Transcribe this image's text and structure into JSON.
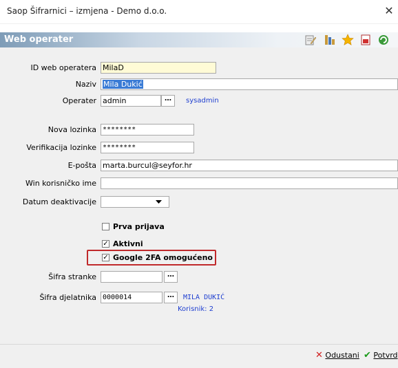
{
  "window": {
    "title": "Saop Šifrarnici – izmjena  - Demo d.o.o.",
    "close_glyph": "✕"
  },
  "header": {
    "title": "Web operater"
  },
  "form": {
    "id_label": "ID web operatera",
    "id_value": "MilaD",
    "naziv_label": "Naziv",
    "naziv_value": "Mila Dukić",
    "operater_label": "Operater",
    "operater_value": "admin",
    "operater_name": "sysadmin",
    "lozinka_label": "Nova lozinka",
    "lozinka_value": "********",
    "verif_label": "Verifikacija lozinke",
    "verif_value": "********",
    "email_label": "E-pošta",
    "email_value": "marta.burcul@seyfor.hr",
    "win_label": "Win korisničko ime",
    "win_value": "",
    "datum_label": "Datum deaktivacije",
    "datum_value": "",
    "prva_label": "Prva prijava",
    "prva_checked": false,
    "aktivni_label": "Aktivni",
    "aktivni_checked": true,
    "google_label": "Google 2FA omogućeno",
    "google_checked": true,
    "stranka_label": "Šifra stranke",
    "stranka_value": "",
    "djelatnik_label": "Šifra djelatnika",
    "djelatnik_value": "0000014",
    "djelatnik_name": "MILA DUKIĆ",
    "korisnik_info": "Korisnik: 2",
    "ellipsis": "…"
  },
  "footer": {
    "cancel_label": "Odustani",
    "confirm_label": "Potvrd"
  },
  "colors": {
    "accent_blue": "#1f3fd0",
    "highlight_red": "#c0282a",
    "selected_bg": "#3a7bd5",
    "id_field_bg": "#fffbd6"
  }
}
